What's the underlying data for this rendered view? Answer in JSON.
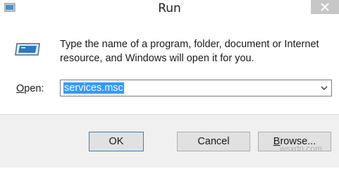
{
  "window": {
    "title": "Run",
    "close_symbol": "✕"
  },
  "content": {
    "description_line1": "Type the name of a program, folder, document or Internet",
    "description_line2": "resource, and Windows will open it for you.",
    "open_label_accel": "O",
    "open_label_rest": "pen:",
    "open_value": "services.msc"
  },
  "buttons": {
    "ok_label": "OK",
    "cancel_label": "Cancel",
    "browse_label_accel": "B",
    "browse_label_rest": "rowse..."
  },
  "watermark": "wsxdn.com",
  "icons": {
    "app": "run-app-icon",
    "run": "run-dialog-icon",
    "close": "close-icon",
    "dropdown": "chevron-down-icon"
  }
}
